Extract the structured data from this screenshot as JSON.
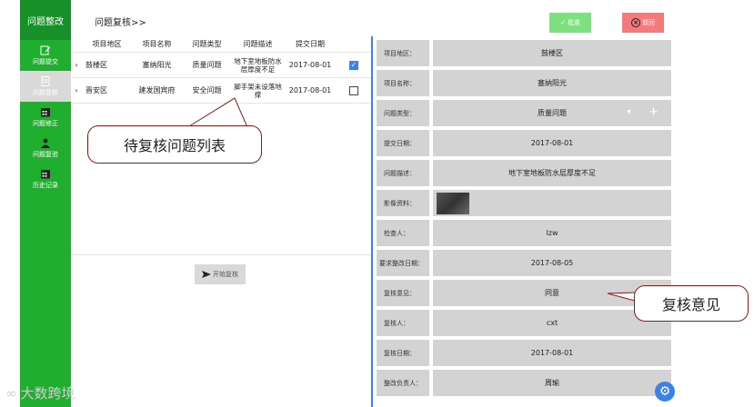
{
  "app": {
    "title": "问题整改"
  },
  "sidebar": {
    "items": [
      {
        "label": "问题提交",
        "icon": "edit-icon",
        "active": false
      },
      {
        "label": "问题复核",
        "icon": "document-icon",
        "active": true
      },
      {
        "label": "问题修正",
        "icon": "calendar-icon",
        "active": false
      },
      {
        "label": "问题复验",
        "icon": "person-icon",
        "active": false
      },
      {
        "label": "历史记录",
        "icon": "calendar-icon",
        "active": false
      }
    ]
  },
  "header": {
    "title": "问题复核>>",
    "approve_label": "批准",
    "return_label": "驳回",
    "return_icon": "×"
  },
  "list": {
    "headers": [
      "项目地区",
      "项目名称",
      "问题类型",
      "问题描述",
      "提交日期"
    ],
    "rows": [
      {
        "region": "鼓楼区",
        "project": "塞纳阳光",
        "type": "质量问题",
        "desc": "地下室地板防水层厚度不足",
        "date": "2017-08-01",
        "checked": true,
        "check_mark": "✓"
      },
      {
        "region": "晋安区",
        "project": "建发国宾府",
        "type": "安全问题",
        "desc": "脚手架未设落地撑",
        "date": "2017-08-01",
        "checked": false,
        "check_mark": ""
      }
    ],
    "start_label": "开始复核"
  },
  "detail": {
    "fields": [
      {
        "label": "项目地区：",
        "value": "鼓楼区"
      },
      {
        "label": "项目名称：",
        "value": "塞纳阳光"
      },
      {
        "label": "问题类型：",
        "value": "质量问题"
      },
      {
        "label": "提交日期：",
        "value": "2017-08-01"
      },
      {
        "label": "问题描述：",
        "value": "地下室地板防水层厚度不足"
      },
      {
        "label": "影像资料：",
        "value": ""
      },
      {
        "label": "检查人：",
        "value": "lzw"
      },
      {
        "label": "要求整改日期：",
        "value": "2017-08-05"
      },
      {
        "label": "复核意见：",
        "value": "同意"
      },
      {
        "label": "复核人：",
        "value": "cxt"
      },
      {
        "label": "复核日期：",
        "value": "2017-08-01"
      },
      {
        "label": "整改负责人：",
        "value": "周瑜"
      }
    ]
  },
  "callouts": {
    "list": "待复核问题列表",
    "opinion": "复核意见"
  },
  "watermark": {
    "text": "大数跨境"
  },
  "colors": {
    "sidebar": "#1fae2e",
    "accent": "#3b82e6",
    "approve": "#7ee07e",
    "return": "#f37b7b",
    "field_bg": "#d3d3d3"
  }
}
